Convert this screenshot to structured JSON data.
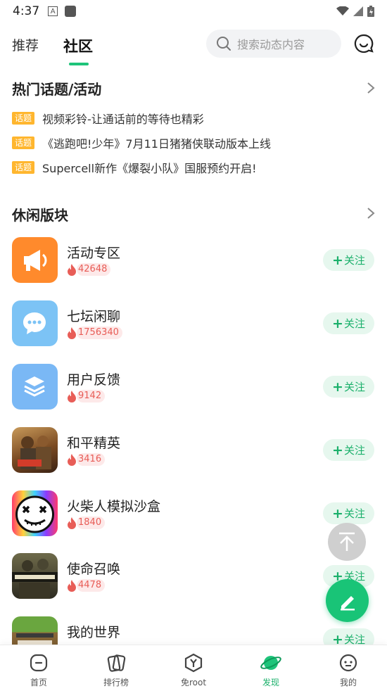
{
  "status_bar": {
    "time": "4:37",
    "a_icon": "A"
  },
  "header": {
    "tabs": [
      "推荐",
      "社区"
    ],
    "active_tab": "社区",
    "search_placeholder": "搜索动态内容"
  },
  "hot_topics": {
    "title": "热门话题/活动",
    "tag": "话题",
    "items": [
      "视频彩铃-让通话前的等待也精彩",
      "《逃跑吧!少年》7月11日猪猪侠联动版本上线",
      "Supercell新作《爆裂小队》国服预约开启!"
    ]
  },
  "leisure": {
    "title": "休闲版块",
    "follow_label": "关注",
    "items": [
      {
        "name": "活动专区",
        "heat": "42648",
        "icon": "megaphone-icon",
        "color": "#ff8a2c"
      },
      {
        "name": "七坛闲聊",
        "heat": "1756340",
        "icon": "chat-bubble-icon",
        "color": "#7cc3f5"
      },
      {
        "name": "用户反馈",
        "heat": "9142",
        "icon": "layers-icon",
        "color": "#7ab8f5"
      },
      {
        "name": "和平精英",
        "heat": "3416",
        "icon": "game-peace-elite-icon",
        "color": "#b07a3a"
      },
      {
        "name": "火柴人模拟沙盒",
        "heat": "1840",
        "icon": "game-stickman-icon",
        "color": "#ffffff"
      },
      {
        "name": "使命召唤",
        "heat": "4478",
        "icon": "game-call-of-duty-icon",
        "color": "#4a4a3a"
      },
      {
        "name": "我的世界",
        "heat": "",
        "icon": "game-minecraft-icon",
        "color": "#6aa63f"
      }
    ]
  },
  "bottom_nav": {
    "items": [
      "首页",
      "排行榜",
      "免root",
      "发现",
      "我的"
    ],
    "active": "发现"
  },
  "colors": {
    "accent": "#1ec47a",
    "tag": "#ffb62e",
    "heat": "#e85d57"
  }
}
